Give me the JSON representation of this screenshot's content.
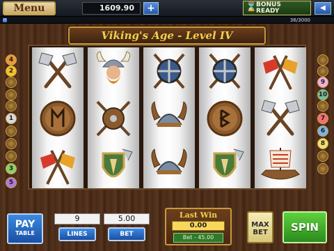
{
  "header": {
    "menu_label": "Menu",
    "balance": "1609.90",
    "add_label": "+",
    "bonus_line1": "BONUS",
    "bonus_line2": "READY",
    "xp_text": "36/3000",
    "xp_progress": 0.012
  },
  "machine": {
    "title": "Viking's Age - Level IV",
    "left_markers": [
      "4",
      "2",
      "",
      "",
      "",
      "1",
      "",
      "",
      "",
      "3",
      "5"
    ],
    "right_markers": [
      "",
      "",
      "9",
      "10",
      "",
      "7",
      "6",
      "8",
      "",
      ""
    ],
    "marker_colors": [
      "#d9d9d9",
      "#f2c12e",
      "#8fd06a",
      "#e89a3c",
      "#b07ad8",
      "#7ab4e6",
      "#f27070",
      "#f0e070",
      "#f0b0e0",
      "#70c0a0"
    ],
    "reels": [
      [
        "crossed-axes",
        "rune-shield-m",
        "flag-weapons"
      ],
      [
        "viking-helmet-face",
        "shield-with-axes",
        "green-shield-axe"
      ],
      [
        "round-shield-axes",
        "horned-helmet",
        "horned-helmet"
      ],
      [
        "round-shield-axes",
        "rune-shield-b",
        "green-shield-axe"
      ],
      [
        "flag-weapons",
        "crossed-axes",
        "viking-ship"
      ]
    ]
  },
  "controls": {
    "paytable_big": "PAY",
    "paytable_small": "TABLE",
    "lines_value": "9",
    "lines_label": "LINES",
    "bet_value": "5.00",
    "bet_label": "BET",
    "lastwin_label": "Last Win",
    "lastwin_value": "0.00",
    "bet_total": "Bet - 45.00",
    "maxbet_line1": "MAX",
    "maxbet_line2": "BET",
    "spin_label": "SPIN"
  }
}
